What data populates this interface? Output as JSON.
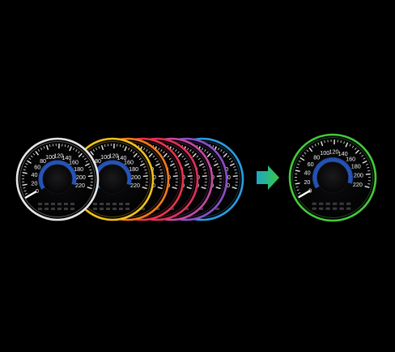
{
  "gauge": {
    "tick_labels": [
      "0",
      "20",
      "40",
      "60",
      "80",
      "100",
      "120",
      "140",
      "160",
      "180",
      "200",
      "220"
    ],
    "needle_value": 0
  },
  "stack": {
    "ring_colors": [
      "#2a9de0",
      "#8a4fc7",
      "#c44aa0",
      "#e0305a",
      "#e8344a",
      "#f07a1a",
      "#f2c01e",
      "#e6e6e6"
    ]
  },
  "result": {
    "ring_color": "#46c83c"
  },
  "arrow": {
    "icon": "right-arrow-icon",
    "gradient_start": "#1fa6c8",
    "gradient_end": "#39c940"
  }
}
